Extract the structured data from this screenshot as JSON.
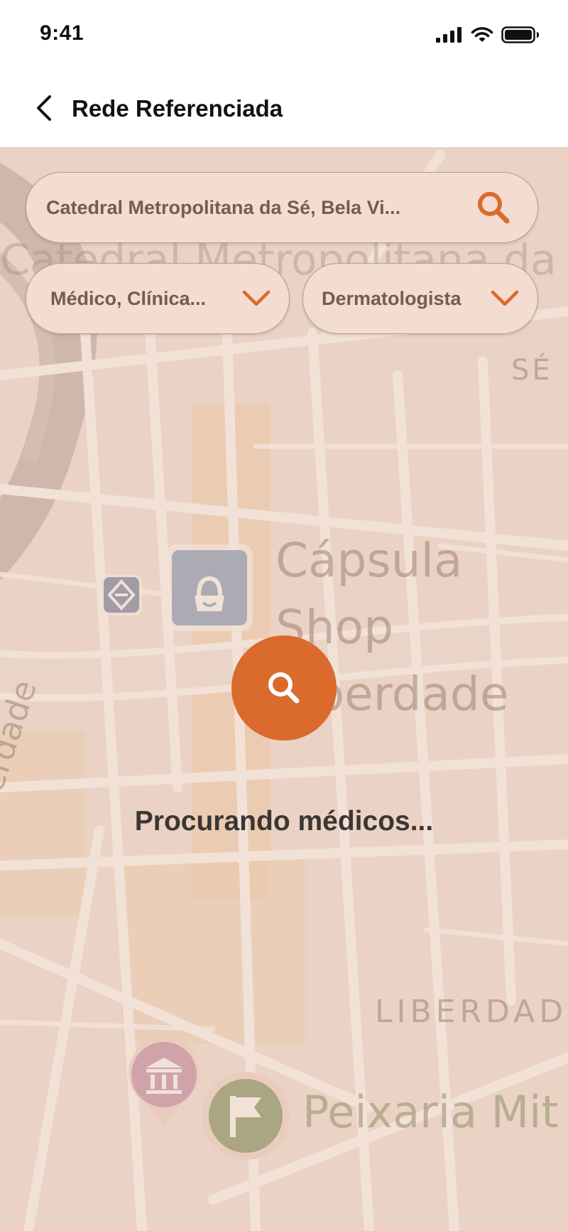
{
  "status_bar": {
    "time": "9:41",
    "icons": [
      "signal-icon",
      "wifi-icon",
      "battery-icon"
    ]
  },
  "header": {
    "back_icon": "chevron-left-icon",
    "title": "Rede Referenciada"
  },
  "search": {
    "value": "Catedral Metropolitana da Sé, Bela Vi...",
    "icon": "search-icon"
  },
  "filters": [
    {
      "label": "Médico, Clínica...",
      "icon": "chevron-down-icon"
    },
    {
      "label": "Dermatologista",
      "icon": "chevron-down-icon"
    }
  ],
  "map": {
    "labels": {
      "catedral": "Catedral Metropolitana da Sé",
      "se": "SÉ",
      "shop": "Cápsula Shop Liberdade",
      "liberdade": "LIBERDADE",
      "peixaria": "Peixaria Mit",
      "street": "Liberdade"
    }
  },
  "loading": {
    "text": "Procurando médicos...",
    "icon": "search-icon"
  },
  "colors": {
    "accent": "#db6a2d",
    "pill_bg": "#f3dcd0",
    "pill_text": "#7a5a4e"
  }
}
